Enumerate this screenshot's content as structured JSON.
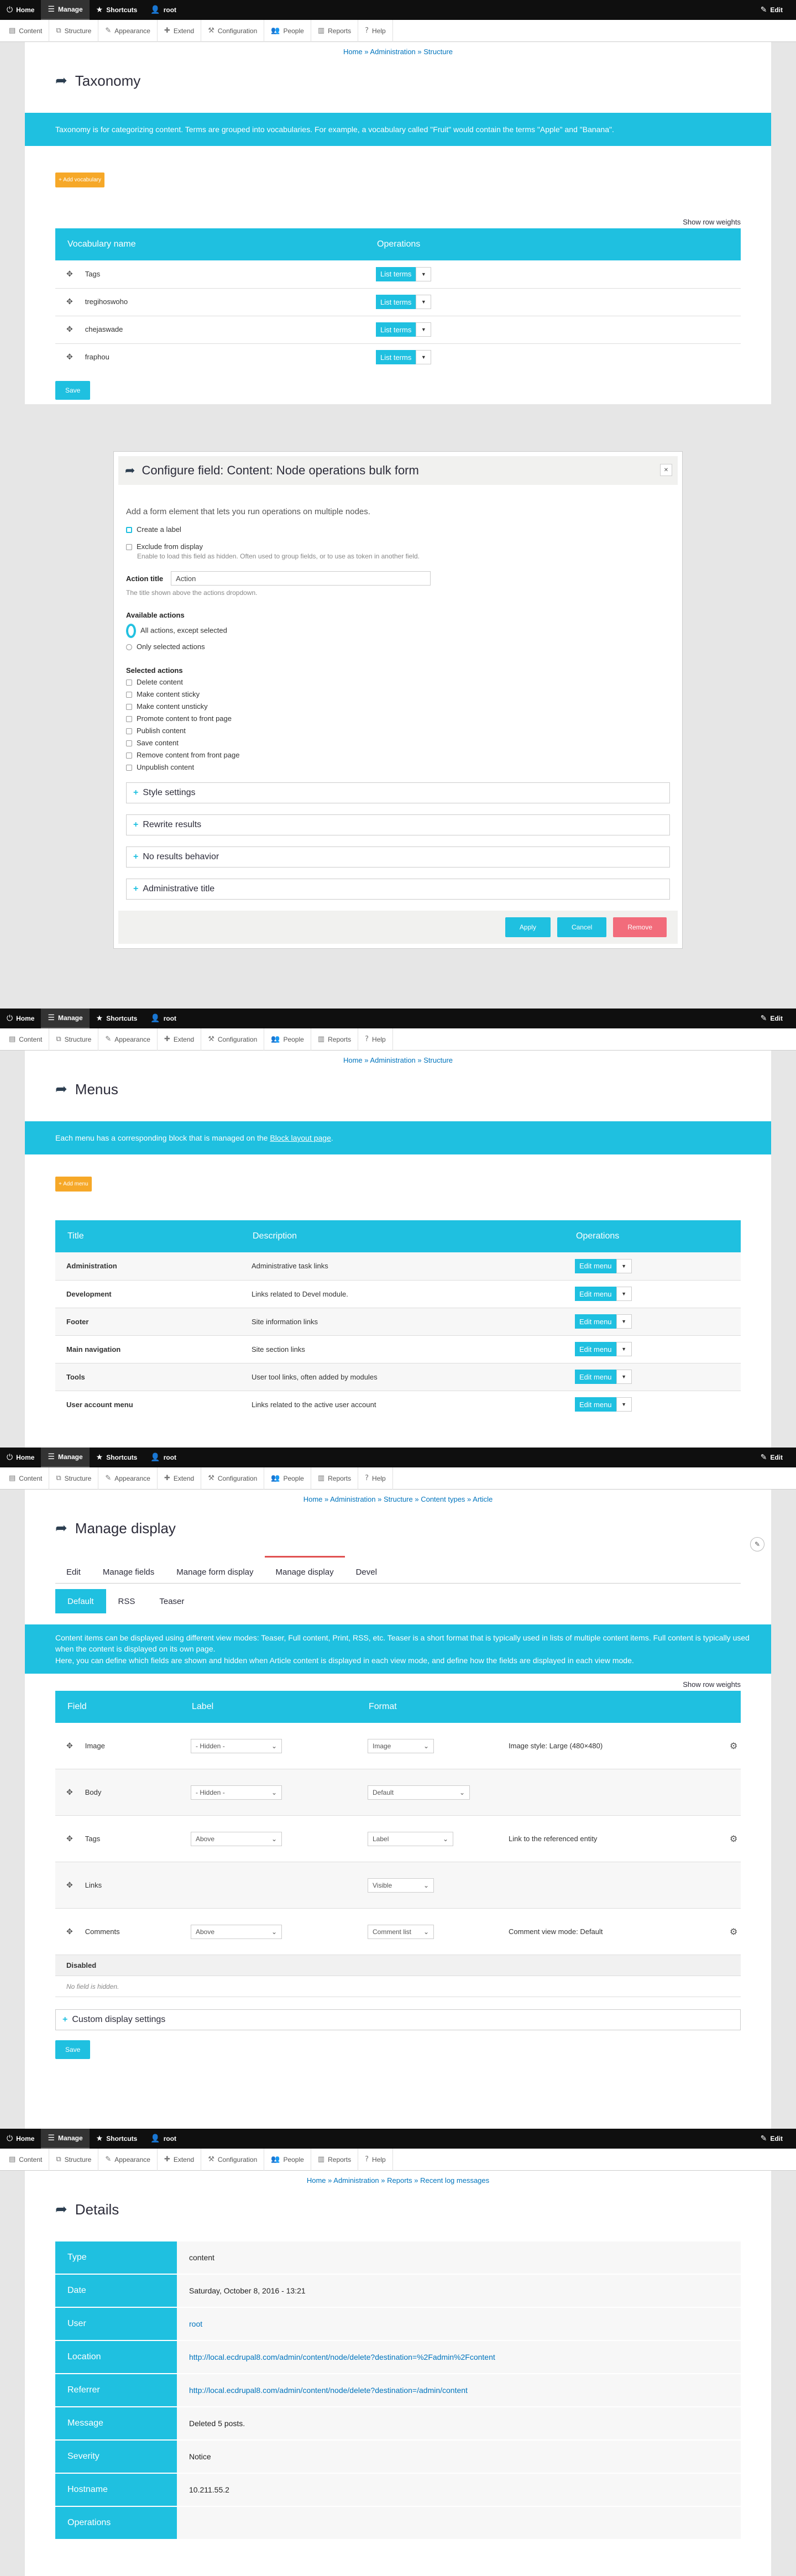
{
  "toolbar": {
    "home": "Home",
    "manage": "Manage",
    "shortcuts": "Shortcuts",
    "user": "root",
    "edit": "Edit"
  },
  "tray": [
    "Content",
    "Structure",
    "Appearance",
    "Extend",
    "Configuration",
    "People",
    "Reports",
    "Help"
  ],
  "taxonomy": {
    "breadcrumb": [
      "Home",
      "Administration",
      "Structure"
    ],
    "title": "Taxonomy",
    "info": "Taxonomy is for categorizing content. Terms are grouped into vocabularies. For example, a vocabulary called \"Fruit\" would contain the terms \"Apple\" and \"Banana\".",
    "add": "+ Add vocabulary",
    "row_weights": "Show row weights",
    "columns": [
      "Vocabulary name",
      "Operations"
    ],
    "rows": [
      "Tags",
      "tregihoswoho",
      "chejaswade",
      "fraphou"
    ],
    "op_label": "List terms",
    "save": "Save"
  },
  "modal": {
    "title": "Configure field: Content: Node operations bulk form",
    "intro": "Add a form element that lets you run operations on multiple nodes.",
    "create_label": "Create a label",
    "exclude": "Exclude from display",
    "exclude_desc": "Enable to load this field as hidden. Often used to group fields, or to use as token in another field.",
    "action_title_label": "Action title",
    "action_title_value": "Action",
    "action_title_desc": "The title shown above the actions dropdown.",
    "available_label": "Available actions",
    "available": [
      "All actions, except selected",
      "Only selected actions"
    ],
    "selected_label": "Selected actions",
    "selected": [
      "Delete content",
      "Make content sticky",
      "Make content unsticky",
      "Promote content to front page",
      "Publish content",
      "Save content",
      "Remove content from front page",
      "Unpublish content"
    ],
    "fieldsets": [
      "Style settings",
      "Rewrite results",
      "No results behavior",
      "Administrative title"
    ],
    "apply": "Apply",
    "cancel": "Cancel",
    "remove": "Remove"
  },
  "menus": {
    "breadcrumb": [
      "Home",
      "Administration",
      "Structure"
    ],
    "title": "Menus",
    "info_prefix": "Each menu has a corresponding block that is managed on the ",
    "info_link": "Block layout page",
    "info_suffix": ".",
    "add": "+ Add menu",
    "columns": [
      "Title",
      "Description",
      "Operations"
    ],
    "rows": [
      {
        "title": "Administration",
        "desc": "Administrative task links"
      },
      {
        "title": "Development",
        "desc": "Links related to Devel module."
      },
      {
        "title": "Footer",
        "desc": "Site information links"
      },
      {
        "title": "Main navigation",
        "desc": "Site section links"
      },
      {
        "title": "Tools",
        "desc": "User tool links, often added by modules"
      },
      {
        "title": "User account menu",
        "desc": "Links related to the active user account"
      }
    ],
    "op_label": "Edit menu"
  },
  "display": {
    "breadcrumb": [
      "Home",
      "Administration",
      "Structure",
      "Content types",
      "Article"
    ],
    "title": "Manage display",
    "tabs": [
      "Edit",
      "Manage fields",
      "Manage form display",
      "Manage display",
      "Devel"
    ],
    "subtabs": [
      "Default",
      "RSS",
      "Teaser"
    ],
    "info1": "Content items can be displayed using different view modes: Teaser, Full content, Print, RSS, etc. Teaser is a short format that is typically used in lists of multiple content items. Full content is typically used when the content is displayed on its own page.",
    "info2": "Here, you can define which fields are shown and hidden when Article content is displayed in each view mode, and define how the fields are displayed in each view mode.",
    "row_weights": "Show row weights",
    "columns": [
      "Field",
      "Label",
      "Format"
    ],
    "rows": [
      {
        "field": "Image",
        "label": "- Hidden -",
        "format": "Image",
        "summary": "Image style: Large (480×480)",
        "gear": true
      },
      {
        "field": "Body",
        "label": "- Hidden -",
        "format": "Default",
        "summary": "",
        "gear": false
      },
      {
        "field": "Tags",
        "label": "Above",
        "format": "Label",
        "summary": "Link to the referenced entity",
        "gear": true
      },
      {
        "field": "Links",
        "label": "",
        "format": "Visible",
        "summary": "",
        "gear": false
      },
      {
        "field": "Comments",
        "label": "Above",
        "format": "Comment list",
        "summary": "Comment view mode: Default",
        "gear": true
      }
    ],
    "disabled": "Disabled",
    "no_field": "No field is hidden.",
    "custom": "Custom display settings",
    "save": "Save"
  },
  "details": {
    "breadcrumb": [
      "Home",
      "Administration",
      "Reports",
      "Recent log messages"
    ],
    "title": "Details",
    "rows": [
      {
        "k": "Type",
        "v": "content",
        "link": false
      },
      {
        "k": "Date",
        "v": "Saturday, October 8, 2016 - 13:21",
        "link": false
      },
      {
        "k": "User",
        "v": "root",
        "link": true
      },
      {
        "k": "Location",
        "v": "http://local.ecdrupal8.com/admin/content/node/delete?destination=%2Fadmin%2Fcontent",
        "link": true
      },
      {
        "k": "Referrer",
        "v": "http://local.ecdrupal8.com/admin/content/node/delete?destination=/admin/content",
        "link": true
      },
      {
        "k": "Message",
        "v": "Deleted 5 posts.",
        "link": false
      },
      {
        "k": "Severity",
        "v": "Notice",
        "link": false
      },
      {
        "k": "Hostname",
        "v": "10.211.55.2",
        "link": false
      },
      {
        "k": "Operations",
        "v": "",
        "link": false
      }
    ]
  },
  "colors": {
    "accent": "#1fc0e0",
    "warning": "#f6a828",
    "danger": "#f26c7b",
    "toolbar": "#0f0f0f"
  }
}
